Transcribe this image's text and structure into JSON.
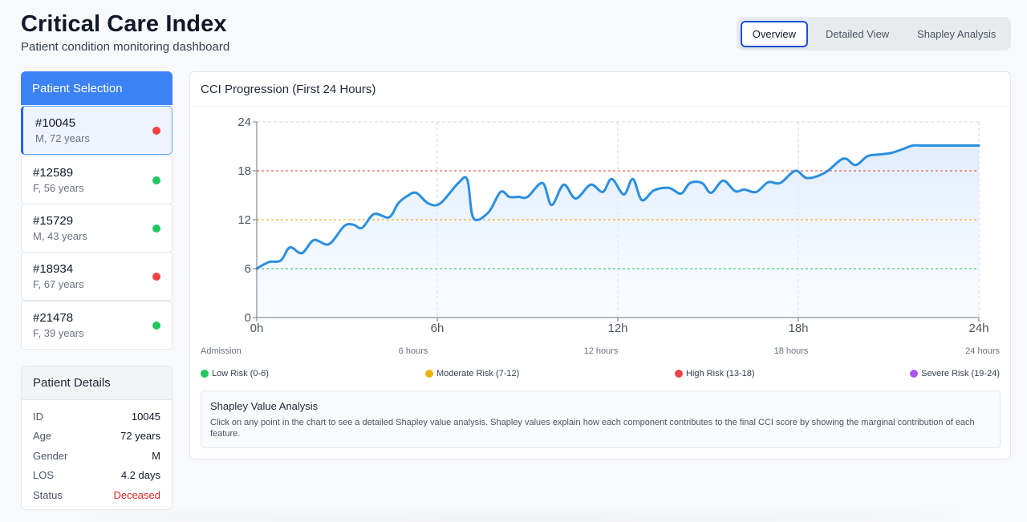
{
  "header": {
    "title": "Critical Care Index",
    "subtitle": "Patient condition monitoring dashboard"
  },
  "tabs": [
    {
      "label": "Overview",
      "active": true
    },
    {
      "label": "Detailed View",
      "active": false
    },
    {
      "label": "Shapley Analysis",
      "active": false
    }
  ],
  "patient_selection": {
    "title": "Patient Selection",
    "patients": [
      {
        "id": "#10045",
        "meta": "M, 72 years",
        "status_color": "#ef4444",
        "selected": true
      },
      {
        "id": "#12589",
        "meta": "F, 56 years",
        "status_color": "#22c55e",
        "selected": false
      },
      {
        "id": "#15729",
        "meta": "M, 43 years",
        "status_color": "#22c55e",
        "selected": false
      },
      {
        "id": "#18934",
        "meta": "F, 67 years",
        "status_color": "#ef4444",
        "selected": false
      },
      {
        "id": "#21478",
        "meta": "F, 39 years",
        "status_color": "#22c55e",
        "selected": false
      }
    ]
  },
  "patient_details": {
    "title": "Patient Details",
    "rows": [
      {
        "label": "ID",
        "value": "10045"
      },
      {
        "label": "Age",
        "value": "72 years"
      },
      {
        "label": "Gender",
        "value": "M"
      },
      {
        "label": "LOS",
        "value": "4.2 days"
      },
      {
        "label": "Status",
        "value": "Deceased",
        "color": "#dc2626"
      }
    ]
  },
  "chart_panel": {
    "title": "CCI Progression (First 24 Hours)",
    "time_labels": [
      "Admission",
      "6 hours",
      "12 hours",
      "18 hours",
      "24 hours"
    ],
    "legend": [
      {
        "label": "Low Risk (0-6)",
        "color": "#22c55e"
      },
      {
        "label": "Moderate Risk (7-12)",
        "color": "#eab308"
      },
      {
        "label": "High Risk (13-18)",
        "color": "#ef4444"
      },
      {
        "label": "Severe Risk (19-24)",
        "color": "#a855f7"
      }
    ],
    "shapley": {
      "title": "Shapley Value Analysis",
      "text": "Click on any point in the chart to see a detailed Shapley value analysis. Shapley values explain how each component contributes to the final CCI score by showing the marginal contribution of each feature."
    }
  },
  "chart_data": {
    "type": "area",
    "title": "",
    "xlabel": "",
    "ylabel": "",
    "xlim": [
      0,
      24
    ],
    "ylim": [
      0,
      24
    ],
    "x_ticks": [
      "0h",
      "6h",
      "12h",
      "18h",
      "24h"
    ],
    "y_ticks": [
      0,
      6,
      12,
      18,
      24
    ],
    "grid": true,
    "line_color": "#2b8fe0",
    "thresholds": [
      {
        "y": 6,
        "color": "#22c55e"
      },
      {
        "y": 12,
        "color": "#f59e0b"
      },
      {
        "y": 18,
        "color": "#ef4444"
      }
    ],
    "series": [
      {
        "x": [
          0,
          0.4,
          0.8,
          1.1,
          1.5,
          1.9,
          2.4,
          2.9,
          3.2,
          3.5,
          3.9,
          4.4,
          4.7,
          5.0,
          5.3,
          5.7,
          6.1,
          6.7,
          7.0,
          7.2,
          7.7,
          8.1,
          8.4,
          8.7,
          9.0,
          9.5,
          9.8,
          10.2,
          10.6,
          11.1,
          11.5,
          11.8,
          12.2,
          12.5,
          12.8,
          13.2,
          13.7,
          14.1,
          14.4,
          14.8,
          15.1,
          15.5,
          15.9,
          16.2,
          16.6,
          17.0,
          17.4,
          17.9,
          18.3,
          18.9,
          19.5,
          19.9,
          20.3,
          20.7,
          21.1,
          21.5,
          21.8,
          22.1,
          22.4,
          22.8,
          23.2,
          23.6,
          24.0
        ],
        "y": [
          6.0,
          6.8,
          7.0,
          8.6,
          7.9,
          9.5,
          9.0,
          11.2,
          11.4,
          11.0,
          12.7,
          12.3,
          14.0,
          14.9,
          15.3,
          14.0,
          14.0,
          16.5,
          16.9,
          12.2,
          12.9,
          15.4,
          14.8,
          14.8,
          14.8,
          16.5,
          13.8,
          16.3,
          14.6,
          16.3,
          15.4,
          17.0,
          15.1,
          17.0,
          14.4,
          15.6,
          15.9,
          15.2,
          16.5,
          16.5,
          15.3,
          16.8,
          15.5,
          15.7,
          15.4,
          16.6,
          16.5,
          18.0,
          17.1,
          17.8,
          19.5,
          18.7,
          19.8,
          20.0,
          20.2,
          20.7,
          21.1,
          21.1,
          21.1,
          21.1,
          21.1,
          21.1,
          21.1
        ]
      }
    ]
  }
}
